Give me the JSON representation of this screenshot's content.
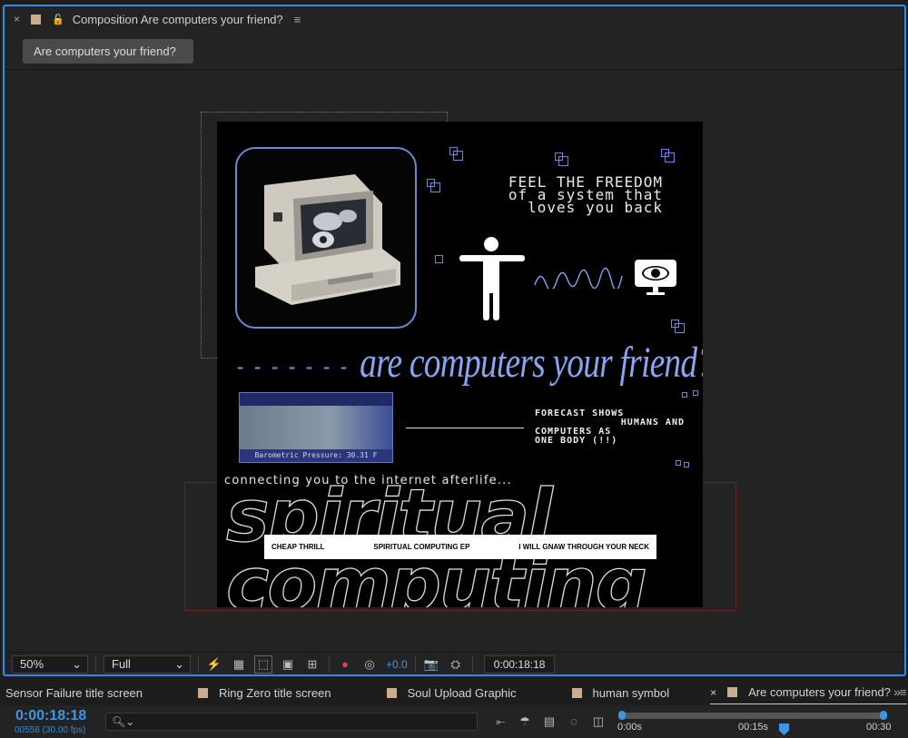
{
  "panel": {
    "close": "×",
    "lock": "🔓",
    "title": "Composition Are computers your friend?",
    "menu": "≡",
    "breadcrumb": "Are computers your friend?"
  },
  "artwork": {
    "freedom_lines": [
      "FEEL THE FREEDOM",
      "of a system that",
      "loves you back"
    ],
    "headline_dashes": "- - - - - - -",
    "headline": "are computers your friend?",
    "weather_caption": "Barometric Pressure: 30.31 F",
    "forecast_lines": [
      "FORECAST SHOWS",
      "HUMANS AND",
      "COMPUTERS AS",
      "ONE BODY (!!)"
    ],
    "connecting": "connecting you to the internet afterlife...",
    "outline_line1": "spiritual",
    "outline_line2": "computing",
    "tracklist": [
      "CHEAP THRILL",
      "SPIRITUAL COMPUTING EP",
      "I WILL GNAW THROUGH YOUR NECK"
    ]
  },
  "toolbar": {
    "zoom": "50%",
    "resolution": "Full",
    "exposure": "+0.0",
    "timecode": "0:00:18:18"
  },
  "tabs": [
    {
      "label": "Sensor Failure title screen",
      "active": false
    },
    {
      "label": "Ring Zero title screen",
      "active": false
    },
    {
      "label": "Soul Upload Graphic",
      "active": false
    },
    {
      "label": "human symbol",
      "active": false
    },
    {
      "label": "Are computers your friend?",
      "active": true
    }
  ],
  "timeline": {
    "current_time": "0:00:18:18",
    "frame_info": "00558 (30.00 fps)",
    "search_placeholder": "",
    "ruler_labels": [
      "0:00s",
      "00:15s",
      "00:30"
    ]
  },
  "colors": {
    "accent": "#2d8ceb",
    "headline": "#8aa4ef",
    "swatch": "#c9ae8d"
  }
}
